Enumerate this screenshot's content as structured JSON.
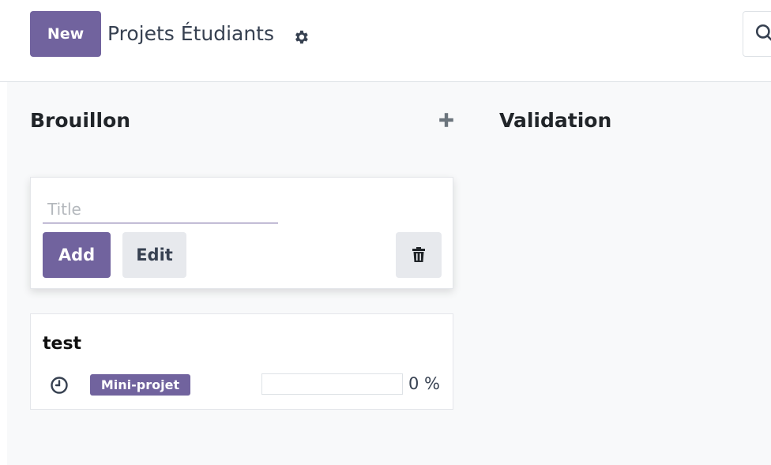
{
  "control_panel": {
    "new_label": "New",
    "breadcrumb_title": "Projets Étudiants",
    "gear_icon": "gear-icon",
    "search_icon": "search-icon"
  },
  "kanban": {
    "columns": [
      {
        "title": "Brouillon",
        "add_icon": "plus-icon"
      },
      {
        "title": "Validation"
      }
    ],
    "quick_create": {
      "title_placeholder": "Title",
      "title_value": "",
      "add_label": "Add",
      "edit_label": "Edit",
      "delete_icon": "trash-icon"
    },
    "records": [
      {
        "name": "test",
        "activity_icon": "clock-icon",
        "tag": "Mini-projet",
        "progress": 0,
        "progress_label": "0 %"
      }
    ]
  },
  "colors": {
    "primary": "#71639e",
    "secondary_btn": "#e7e9ed",
    "kanban_bg": "#f8f9fa"
  }
}
